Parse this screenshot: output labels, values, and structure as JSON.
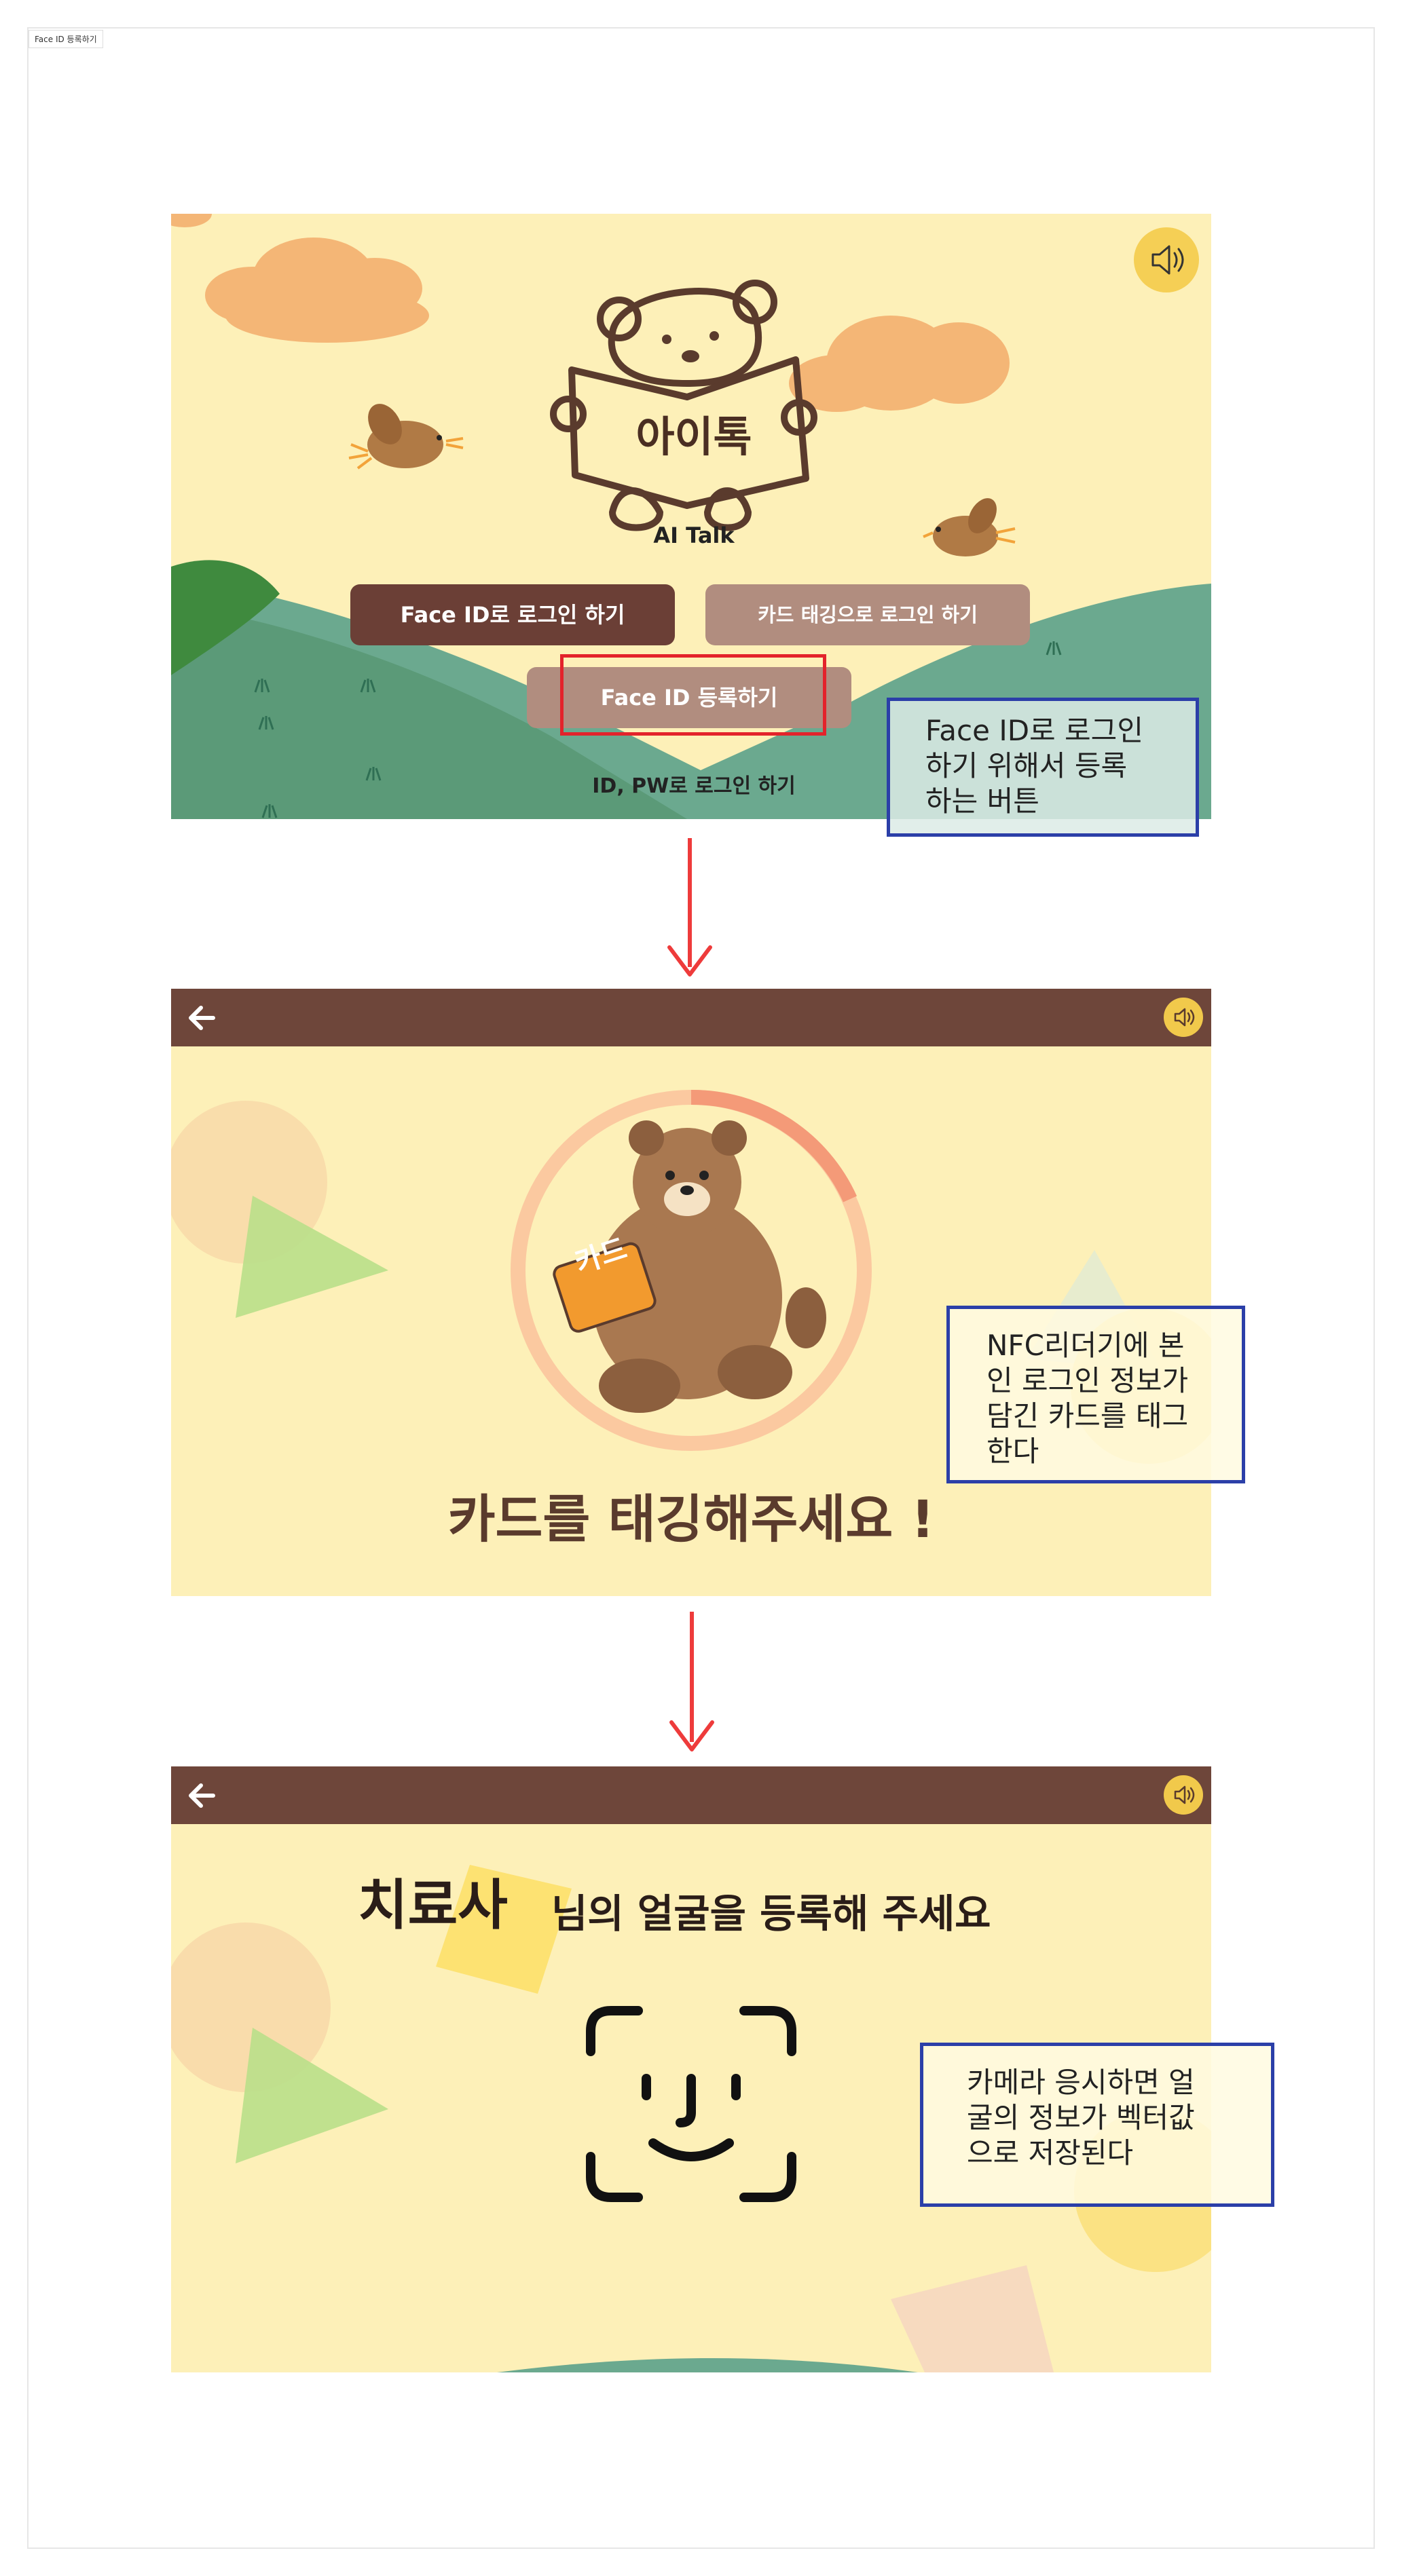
{
  "frame": {
    "label": "Face ID 등록하기"
  },
  "screen1": {
    "logo_title": "아이톡",
    "logo_subtitle": "AI Talk",
    "buttons": {
      "face_login": "Face ID로 로그인 하기",
      "card_login": "카드 태깅으로 로그인 하기",
      "face_register": "Face ID 등록하기"
    },
    "link_idpw": "ID, PW로 로그인 하기",
    "note": "Face ID로 로그인\n하기 위해서 등록\n하는 버튼"
  },
  "screen2": {
    "card_label": "카드",
    "headline": "카드를 태깅해주세요 !",
    "note": "NFC리더기에 본\n인 로그인 정보가\n담긴 카드를 태그\n한다"
  },
  "screen3": {
    "role": "치료사",
    "instruction": "님의 얼굴을 등록해 주세요",
    "note": "카메라 응시하면 얼\n굴의 정보가 벡터값\n으로 저장된다"
  },
  "colors": {
    "topbar": "#6e463a",
    "screen_bg": "#fdf0b8",
    "accent_red": "#e3232b",
    "note_border": "#2b3fa8",
    "btn_dark": "#6b3f36",
    "btn_light": "#b18d7f"
  }
}
